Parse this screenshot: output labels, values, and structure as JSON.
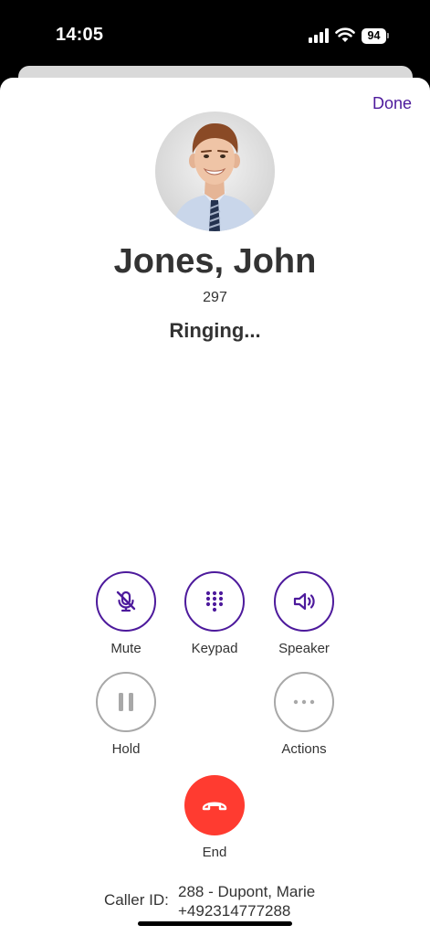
{
  "status_bar": {
    "time": "14:05",
    "battery": "94"
  },
  "header": {
    "done_label": "Done"
  },
  "contact": {
    "name": "Jones, John",
    "extension": "297",
    "call_status": "Ringing..."
  },
  "controls": {
    "mute": "Mute",
    "keypad": "Keypad",
    "speaker": "Speaker",
    "hold": "Hold",
    "actions": "Actions",
    "end": "End"
  },
  "caller_id": {
    "label": "Caller ID:",
    "name": "288 - Dupont, Marie",
    "number": "+492314777288"
  },
  "colors": {
    "accent": "#4d1a9c",
    "end_call": "#ff3b30",
    "disabled": "#a8a8a8",
    "text": "#333333"
  }
}
